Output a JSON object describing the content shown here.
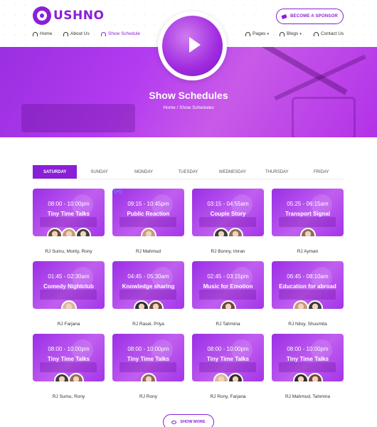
{
  "header": {
    "logo_text": "USHNO",
    "sponsor_label": "BECOME A SPONSOR",
    "nav": [
      {
        "label": "Home",
        "icon": "headphones-icon",
        "chevron": ""
      },
      {
        "label": "About Us",
        "icon": "headphones-icon",
        "chevron": ""
      },
      {
        "label": "Show Schedule",
        "icon": "headphones-icon",
        "chevron": ""
      },
      {
        "label": "Pages",
        "icon": "headphones-icon",
        "chevron": "▾"
      },
      {
        "label": "Blogs",
        "icon": "headphones-icon",
        "chevron": "▾"
      },
      {
        "label": "Contact Us",
        "icon": "headphones-icon",
        "chevron": ""
      }
    ]
  },
  "hero": {
    "title": "Show Schedules",
    "breadcrumb": "Home  /  Show Schedules"
  },
  "days": [
    "SATURDAY",
    "SUNDAY",
    "MONDAY",
    "TUESDAY",
    "WEDNESDAY",
    "THURSDAY",
    "FRIDAY"
  ],
  "active_day": "SATURDAY",
  "cards": [
    {
      "time": "08:00 - 10:00pm",
      "show": "Tiny Time Talks",
      "rj": "RJ Sumu, Monty, Rony",
      "avatars": 3
    },
    {
      "time": "09:15 - 10:45pm",
      "show": "Public Reaction",
      "rj": "RJ Mahmud",
      "avatars": 1
    },
    {
      "time": "03:15 - 04:55am",
      "show": "Couple Story",
      "rj": "RJ Bonny, Imran",
      "avatars": 2
    },
    {
      "time": "05:25 - 06:15am",
      "show": "Transport Signal",
      "rj": "RJ Ayman",
      "avatars": 1
    },
    {
      "time": "01:45 - 02:30am",
      "show": "Comedy Nightclub",
      "rj": "RJ Farjana",
      "avatars": 1
    },
    {
      "time": "04:45 - 05:30am",
      "show": "Knowledge sharing",
      "rj": "RJ Rasel, Priya",
      "avatars": 2
    },
    {
      "time": "02:45 - 03:15pm",
      "show": "Music for Emotion",
      "rj": "RJ Tahmina",
      "avatars": 1
    },
    {
      "time": "06:45 - 08:10am",
      "show": "Education for abroad",
      "rj": "RJ Niloy, Shusmita",
      "avatars": 2
    },
    {
      "time": "08:00 - 10:00pm",
      "show": "Tiny Time Talks",
      "rj": "RJ Sumu, Rony",
      "avatars": 2
    },
    {
      "time": "08:00 - 10:00pm",
      "show": "Tiny Time Talks",
      "rj": "RJ Rony",
      "avatars": 1
    },
    {
      "time": "08:00 - 10:00pm",
      "show": "Tiny Time Talks",
      "rj": "RJ Rony, Farjana",
      "avatars": 2
    },
    {
      "time": "08:00 - 10:00pm",
      "show": "Tiny Time Talks",
      "rj": "RJ Mahmud, Tahmina",
      "avatars": 2
    }
  ],
  "show_more_label": "SHOW MORE",
  "colors": {
    "accent": "#8a1fd8",
    "hero": "#b33bf0"
  }
}
